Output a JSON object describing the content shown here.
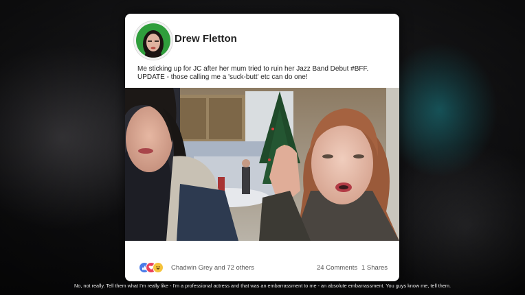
{
  "post": {
    "author": "Drew Fletton",
    "caption_line1": "Me sticking up for JC after her mum tried to ruin her Jazz Band Debut  #BFF.",
    "caption_line2": "UPDATE - those calling me a 'suck-butt' etc can do one!",
    "reactions": [
      "like-icon",
      "love-icon",
      "haha-icon"
    ],
    "reaction_colors": {
      "like": "#4a7be8",
      "love": "#e9405b",
      "haha": "#f5c33b"
    },
    "likers": "Chadwin Grey and 72 others",
    "comments": "24 Comments",
    "shares": "1 Shares"
  },
  "subtitle": "No, not really. Tell them what I'm really like - I'm a professional actress and that was an embarrassment to me - an absolute embarrassment. You guys know me, tell them."
}
